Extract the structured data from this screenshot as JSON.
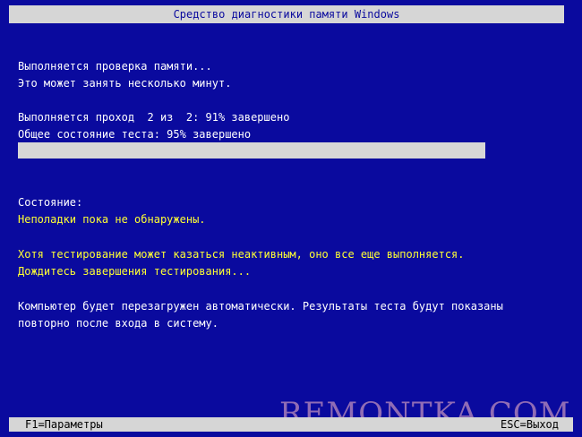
{
  "title": "Средство диагностики памяти Windows",
  "messages": {
    "checking": "Выполняется проверка памяти...",
    "may_take": "Это может занять несколько минут."
  },
  "pass": {
    "text": "Выполняется проход  2 из  2: 91% завершено"
  },
  "overall": {
    "text": "Общее состояние теста: 95% завершено",
    "progress_percent": 95
  },
  "status": {
    "label": "Состояние:",
    "value": "Неполадки пока не обнаружены."
  },
  "notice": {
    "line1": "Хотя тестирование может казаться неактивным, оно все еще выполняется.",
    "line2": "Дождитесь завершения тестирования..."
  },
  "restart": {
    "line1": "Компьютер будет перезагружен автоматически. Результаты теста будут показаны",
    "line2": "повторно после входа в систему."
  },
  "footer": {
    "left": "F1=Параметры",
    "right": "ESC=Выход"
  },
  "watermark": "REMONTKA.COM",
  "colors": {
    "background": "#0a0a9e",
    "bar": "#d6d6d6",
    "highlight_text": "#ffff33"
  }
}
